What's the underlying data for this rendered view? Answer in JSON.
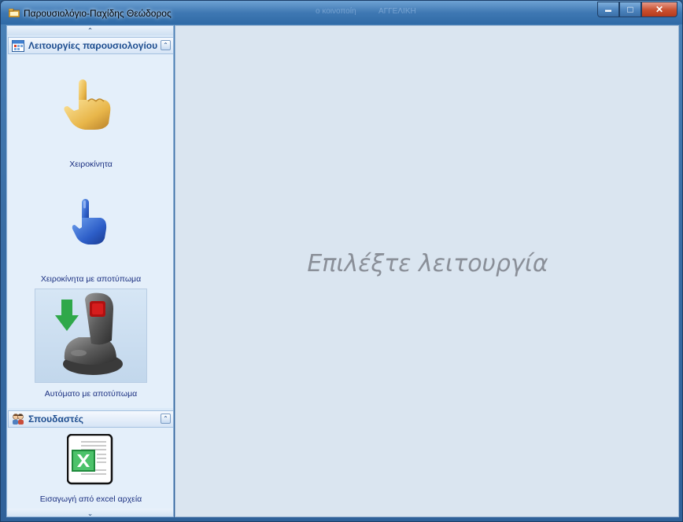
{
  "window": {
    "title": "Παρουσιολόγιο-Παχίδης Θεώδορος",
    "ghost_text_1": "ο κοινοποίη",
    "ghost_text_2": "ΑΓΓΕΛΙΚΗ",
    "buttons": {
      "minimize": "▬",
      "maximize": "□",
      "close": "✕"
    },
    "title_icon": "folder-icon"
  },
  "sidebar": {
    "scroll_up": "⌃",
    "scroll_down": "⌄",
    "groups": [
      {
        "title": "Λειτουργίες παρουσιολογίου",
        "icon": "calendar-icon",
        "collapse": "⌃",
        "items": [
          {
            "label": "Χειροκίνητα",
            "icon": "pointing-hand-gold-icon"
          },
          {
            "label": "Χειροκίνητα με αποτύπωμα",
            "icon": "pointing-hand-blue-icon"
          },
          {
            "label": "Αυτόματο με αποτύπωμα",
            "icon": "fingerprint-scanner-icon"
          }
        ]
      },
      {
        "title": "Σπουδαστές",
        "icon": "students-icon",
        "collapse": "⌃",
        "items": [
          {
            "label": "Εισαγωγή από excel αρχεία",
            "icon": "excel-file-icon"
          }
        ]
      }
    ]
  },
  "content": {
    "placeholder": "Επιλέξτε λειτουργία"
  },
  "colors": {
    "title_bar": "#3f78b3",
    "sidebar_bg": "#e4effa",
    "group_title": "#1d4d8f",
    "item_label": "#1a2f80",
    "content_bg": "#dae5f0",
    "placeholder": "#8a8f98",
    "close_button": "#c9502f"
  }
}
